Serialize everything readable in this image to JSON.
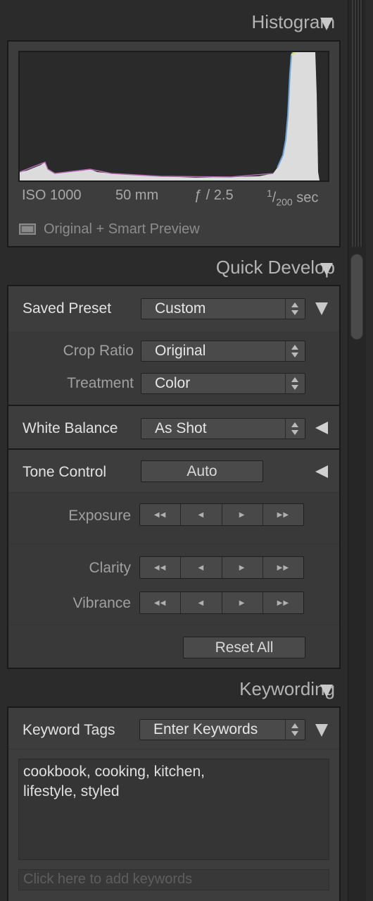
{
  "histogram": {
    "title": "Histogram",
    "iso": "ISO 1000",
    "focal_length": "50 mm",
    "aperture": "ƒ / 2.5",
    "shutter_numerator": "1",
    "shutter_denominator": "200",
    "shutter_unit": "sec",
    "preview_status": "Original + Smart Preview"
  },
  "quick_develop": {
    "title": "Quick Develop",
    "saved_preset": {
      "label": "Saved Preset",
      "value": "Custom"
    },
    "crop_ratio": {
      "label": "Crop Ratio",
      "value": "Original"
    },
    "treatment": {
      "label": "Treatment",
      "value": "Color"
    },
    "white_balance": {
      "label": "White Balance",
      "value": "As Shot"
    },
    "tone_control": {
      "label": "Tone Control",
      "auto_label": "Auto"
    },
    "exposure": {
      "label": "Exposure"
    },
    "clarity": {
      "label": "Clarity"
    },
    "vibrance": {
      "label": "Vibrance"
    },
    "reset_all_label": "Reset All"
  },
  "keywording": {
    "title": "Keywording",
    "keyword_tags": {
      "label": "Keyword Tags",
      "value": "Enter Keywords"
    },
    "keywords_line1": "cookbook, cooking, kitchen,",
    "keywords_line2": "lifestyle, styled",
    "add_placeholder": "Click here to add keywords"
  },
  "colors": {
    "panel_bg": "#2b2b2b",
    "box_bg": "#3d3d3d",
    "histogram_bg": "#2a2a2a"
  }
}
